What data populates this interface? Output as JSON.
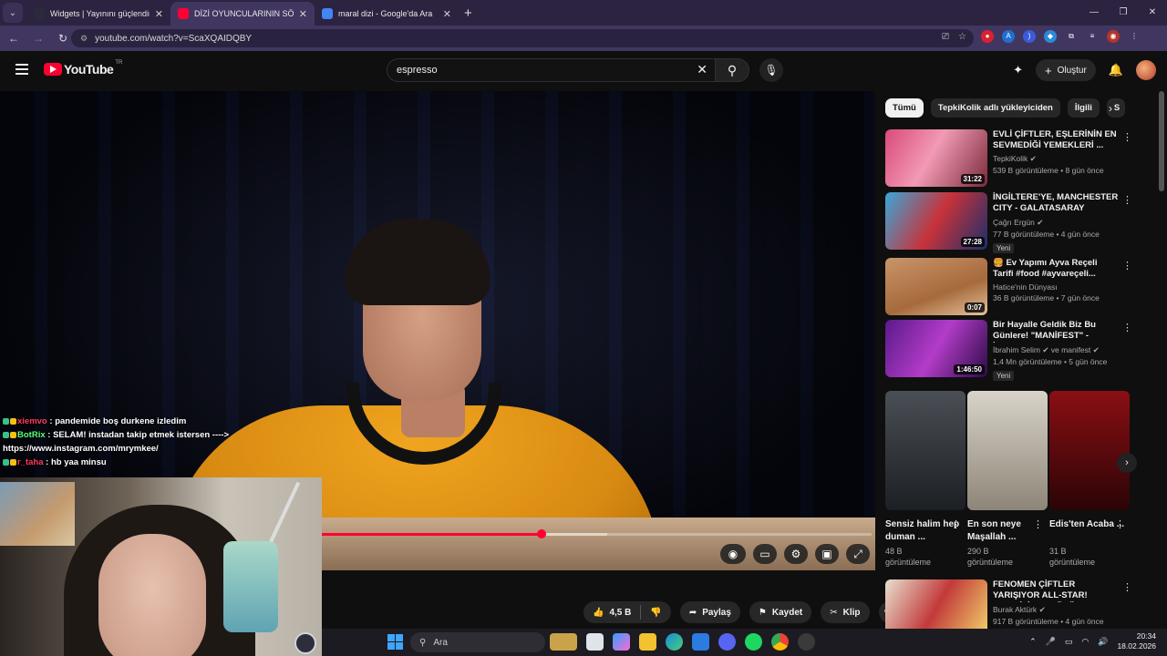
{
  "browser": {
    "tabs": [
      {
        "title": "Widgets | Yayınını güçlendirmek",
        "favicon_color": "#2a2a3a",
        "active": false
      },
      {
        "title": "DİZİ OYUNCULARININ SÖYLEDİ",
        "favicon_color": "#ff0033",
        "active": true
      },
      {
        "title": "maral dizi - Google'da Ara",
        "favicon_color": "#4285f4",
        "active": false
      }
    ],
    "url": "youtube.com/watch?v=ScaXQAIDQBY"
  },
  "youtube": {
    "logo_text": "YouTube",
    "country_code": "TR",
    "search_value": "espresso",
    "create_label": "Oluştur"
  },
  "player": {
    "progress_fraction": 0.4,
    "loaded_fraction": 0.52
  },
  "chat": [
    {
      "user": "xiemvo",
      "user_color": "#ff3b5c",
      "message": " : pandemide boş durkene izledim"
    },
    {
      "user": "BotRix",
      "user_color": "#5cff7a",
      "message": " : SELAM! instadan takip etmek istersen ---->"
    },
    {
      "user": "",
      "user_color": "#ffffff",
      "message": "https://www.instagram.com/mrymkee/"
    },
    {
      "user": "r_taha",
      "user_color": "#ff3b5c",
      "message": " : hb yaa minsu"
    }
  ],
  "actions": {
    "like_count": "4,5 B",
    "share_label": "Paylaş",
    "save_label": "Kaydet",
    "clip_label": "Klip"
  },
  "chips": [
    "Tümü",
    "TepkiKolik adlı yükleyiciden",
    "İlgili",
    "S"
  ],
  "recommendations": [
    {
      "title": "EVLİ ÇİFTLER, EŞLERİNİN EN SEVMEDİĞİ YEMEKLERİ ...",
      "channel": "TepkiKolik",
      "verified": true,
      "stats": "539 B görüntüleme • 8 gün önce",
      "duration": "31:22",
      "badge": "",
      "thumb": "linear-gradient(120deg,#d94a7a,#f29ab5 45%,#7a2a3a)"
    },
    {
      "title": "İNGİLTERE'YE, MANCHESTER CITY - GALATASARAY MAÇIN...",
      "channel": "Çağrı Ergün",
      "verified": true,
      "stats": "77 B görüntüleme • 4 gün önce",
      "duration": "27:28",
      "badge": "Yeni",
      "thumb": "linear-gradient(120deg,#3aa7d8,#c8323a 50%,#1b2f6b)"
    },
    {
      "title": "🍔 Ev Yapımı Ayva Reçeli Tarifi #food #ayvareçeli...",
      "channel": "Hatice'nin Dünyası",
      "verified": false,
      "stats": "36 B görüntüleme • 7 gün önce",
      "duration": "0:07",
      "badge": "",
      "thumb": "linear-gradient(160deg,#c9956a,#a66a3c 60%,#e4c29a)"
    },
    {
      "title": "Bir Hayalle Geldik Biz Bu Günlere! \"MANİFEST\" - İbrahi...",
      "channel": "İbrahim Selim ✔ ve manifest",
      "verified": true,
      "stats": "1,4 Mn görüntüleme • 5 gün önce",
      "duration": "1:46:50",
      "badge": "Yeni",
      "thumb": "linear-gradient(120deg,#5b1a8a,#b33cc8 50%,#2a0b45)"
    },
    {
      "title": "FENOMEN ÇİFTLER YARIŞIYOR ALL-STAR! (SEVGİLİLER GÜNÜ...",
      "channel": "Burak Aktürk",
      "verified": true,
      "stats": "917 B görüntüleme • 4 gün önce",
      "duration": "",
      "badge": "",
      "thumb": "linear-gradient(120deg,#e8e0d0,#c23a3a 50%,#f2d36b)"
    }
  ],
  "shorts": [
    {
      "title": "Sensiz halim hep duman ...",
      "views": "48 B görüntüleme",
      "thumb": "linear-gradient(180deg,#4a4f55,#1c1f24)"
    },
    {
      "title": "En son neye Maşallah ...",
      "views": "290 B görüntüleme",
      "thumb": "linear-gradient(180deg,#d8d3c8,#8d8578)"
    },
    {
      "title": "Edis'ten Acaba ...",
      "views": "31 B görüntüleme",
      "thumb": "linear-gradient(180deg,#8a0f14,#2b0406)"
    }
  ],
  "taskbar": {
    "search_label": "Ara",
    "time": "20:34",
    "date": "18.02.2026"
  }
}
